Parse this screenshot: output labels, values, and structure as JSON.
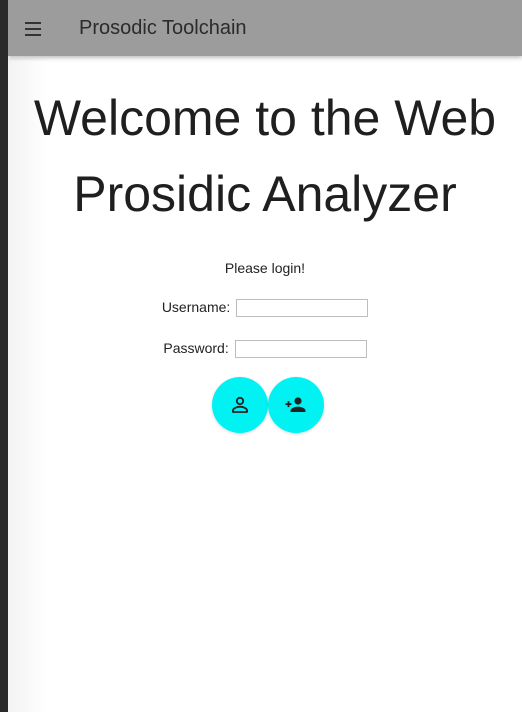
{
  "toolbar": {
    "menu_icon": "menu-icon",
    "title": "Prosodic Toolchain"
  },
  "main": {
    "heading_line1": "Welcome to the Web",
    "heading_line2": "Prosidic Analyzer",
    "prompt": "Please login!",
    "username_label": "Username:",
    "username_value": "",
    "password_label": "Password:",
    "password_value": "",
    "login_icon": "person-outline-icon",
    "register_icon": "person-add-icon"
  },
  "colors": {
    "toolbar": "#9c9c9c",
    "fab": "#00f2f2"
  }
}
